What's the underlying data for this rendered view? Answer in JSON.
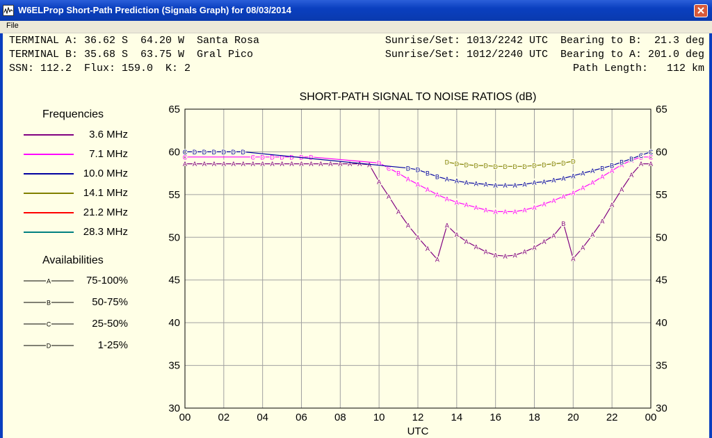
{
  "window": {
    "title": "W6ELProp Short-Path Prediction (Signals Graph) for 08/03/2014"
  },
  "menu": {
    "items": [
      "File"
    ]
  },
  "header": {
    "line1_left": "TERMINAL A: 36.62 S  64.20 W  Santa Rosa",
    "line1_right": "Sunrise/Set: 1013/2242 UTC  Bearing to B:  21.3 deg",
    "line2_left": "TERMINAL B: 35.68 S  63.75 W  Gral Pico",
    "line2_right": "Sunrise/Set: 1012/2240 UTC  Bearing to A: 201.0 deg",
    "line3_left": "SSN: 112.2  Flux: 159.0  K: 2",
    "line3_right": "Path Length:   112 km"
  },
  "legend": {
    "frequencies_heading": "Frequencies",
    "frequencies": [
      {
        "label": "3.6 MHz",
        "color": "#800080"
      },
      {
        "label": "7.1 MHz",
        "color": "#ff00ff"
      },
      {
        "label": "10.0 MHz",
        "color": "#0000a0"
      },
      {
        "label": "14.1 MHz",
        "color": "#808000"
      },
      {
        "label": "21.2 MHz",
        "color": "#ff0000"
      },
      {
        "label": "28.3 MHz",
        "color": "#008080"
      }
    ],
    "availabilities_heading": "Availabilities",
    "availabilities": [
      {
        "marker": "A",
        "label": "75-100%"
      },
      {
        "marker": "B",
        "label": "50-75%"
      },
      {
        "marker": "C",
        "label": "25-50%"
      },
      {
        "marker": "D",
        "label": "1-25%"
      }
    ]
  },
  "chart_data": {
    "type": "line",
    "title": "SHORT-PATH SIGNAL TO NOISE RATIOS (dB)",
    "xlabel": "UTC",
    "ylabel": "",
    "xlim": [
      0,
      24
    ],
    "ylim": [
      30,
      65
    ],
    "x_tick_labels": [
      "00",
      "02",
      "04",
      "06",
      "08",
      "10",
      "12",
      "14",
      "16",
      "18",
      "20",
      "22",
      "00"
    ],
    "y_ticks": [
      30,
      35,
      40,
      45,
      50,
      55,
      60,
      65
    ],
    "grid": true,
    "background": "#ffffe6",
    "series": [
      {
        "name": "3.6 MHz",
        "color": "#800080",
        "points": [
          [
            0,
            58.6,
            "A"
          ],
          [
            0.5,
            58.6,
            "A"
          ],
          [
            1,
            58.6,
            "A"
          ],
          [
            1.5,
            58.6,
            "A"
          ],
          [
            2,
            58.6,
            "A"
          ],
          [
            2.5,
            58.6,
            "A"
          ],
          [
            3,
            58.6,
            "A"
          ],
          [
            3.5,
            58.6,
            "A"
          ],
          [
            4,
            58.6,
            "A"
          ],
          [
            4.5,
            58.6,
            "A"
          ],
          [
            5,
            58.6,
            "A"
          ],
          [
            5.5,
            58.6,
            "A"
          ],
          [
            6,
            58.6,
            "A"
          ],
          [
            6.5,
            58.6,
            "A"
          ],
          [
            7,
            58.6,
            "A"
          ],
          [
            7.5,
            58.6,
            "A"
          ],
          [
            8,
            58.6,
            "A"
          ],
          [
            8.5,
            58.6,
            "A"
          ],
          [
            9,
            58.6,
            "A"
          ],
          [
            9.5,
            58.5,
            "A"
          ],
          [
            10,
            56.5,
            "A"
          ],
          [
            10.5,
            54.8,
            "A"
          ],
          [
            11,
            53.0,
            "A"
          ],
          [
            11.5,
            51.4,
            "A"
          ],
          [
            12,
            50.0,
            "A"
          ],
          [
            12.5,
            48.7,
            "A"
          ],
          [
            13,
            47.4,
            "A"
          ],
          [
            13.5,
            51.4,
            "A"
          ],
          [
            14,
            50.3,
            "A"
          ],
          [
            14.5,
            49.5,
            "A"
          ],
          [
            15,
            48.9,
            "A"
          ],
          [
            15.5,
            48.3,
            "A"
          ],
          [
            16,
            47.9,
            "A"
          ],
          [
            16.5,
            47.8,
            "A"
          ],
          [
            17,
            47.9,
            "A"
          ],
          [
            17.5,
            48.3,
            "A"
          ],
          [
            18,
            48.8,
            "A"
          ],
          [
            18.5,
            49.5,
            "A"
          ],
          [
            19,
            50.2,
            "A"
          ],
          [
            19.5,
            51.6,
            "B"
          ],
          [
            20,
            47.5,
            "A"
          ],
          [
            20.5,
            48.8,
            "A"
          ],
          [
            21,
            50.3,
            "A"
          ],
          [
            21.5,
            51.9,
            "A"
          ],
          [
            22,
            53.8,
            "A"
          ],
          [
            22.5,
            55.6,
            "A"
          ],
          [
            23,
            57.3,
            "A"
          ],
          [
            23.5,
            58.6,
            "A"
          ],
          [
            24,
            58.6,
            "A"
          ]
        ]
      },
      {
        "name": "7.1 MHz",
        "color": "#ff00ff",
        "points": [
          [
            0,
            59.4,
            "C"
          ],
          [
            3,
            59.4,
            null
          ],
          [
            3.5,
            59.4,
            "C"
          ],
          [
            4,
            59.4,
            "D"
          ],
          [
            4.5,
            59.4,
            "D"
          ],
          [
            5,
            59.4,
            "D"
          ],
          [
            5.5,
            59.4,
            "D"
          ],
          [
            6,
            59.4,
            "D"
          ],
          [
            6.5,
            59.4,
            "D"
          ],
          [
            10,
            58.7,
            "D"
          ],
          [
            10.5,
            58.1,
            "C"
          ],
          [
            11,
            57.5,
            "B"
          ],
          [
            11.5,
            56.8,
            "A"
          ],
          [
            12,
            56.2,
            "A"
          ],
          [
            12.5,
            55.6,
            "A"
          ],
          [
            13,
            55.0,
            "A"
          ],
          [
            13.5,
            54.5,
            "A"
          ],
          [
            14,
            54.1,
            "A"
          ],
          [
            14.5,
            53.8,
            "A"
          ],
          [
            15,
            53.5,
            "A"
          ],
          [
            15.5,
            53.2,
            "A"
          ],
          [
            16,
            53.0,
            "A"
          ],
          [
            16.5,
            53.0,
            "A"
          ],
          [
            17,
            53.0,
            "A"
          ],
          [
            17.5,
            53.2,
            "A"
          ],
          [
            18,
            53.5,
            "A"
          ],
          [
            18.5,
            53.9,
            "A"
          ],
          [
            19,
            54.3,
            "A"
          ],
          [
            19.5,
            54.8,
            "A"
          ],
          [
            20,
            55.2,
            "A"
          ],
          [
            20.5,
            55.8,
            "A"
          ],
          [
            21,
            56.4,
            "A"
          ],
          [
            21.5,
            57.1,
            "A"
          ],
          [
            22,
            57.8,
            "A"
          ],
          [
            22.5,
            58.5,
            "A"
          ],
          [
            23,
            59.0,
            "A"
          ],
          [
            23.5,
            59.4,
            "B"
          ],
          [
            24,
            59.4,
            "C"
          ]
        ]
      },
      {
        "name": "10.0 MHz",
        "color": "#0000a0",
        "points": [
          [
            0,
            60.0,
            "C"
          ],
          [
            0.5,
            60.0,
            "D"
          ],
          [
            1,
            60.0,
            "D"
          ],
          [
            1.5,
            60.0,
            "D"
          ],
          [
            2,
            60.0,
            "D"
          ],
          [
            2.5,
            60.0,
            "D"
          ],
          [
            3,
            60.0,
            "D"
          ],
          [
            11.5,
            58.1,
            "D"
          ],
          [
            12,
            57.9,
            "D"
          ],
          [
            12.5,
            57.5,
            "B"
          ],
          [
            13,
            57.1,
            "B"
          ],
          [
            13.5,
            56.8,
            "A"
          ],
          [
            14,
            56.6,
            "A"
          ],
          [
            14.5,
            56.4,
            "A"
          ],
          [
            15,
            56.3,
            "A"
          ],
          [
            15.5,
            56.2,
            "A"
          ],
          [
            16,
            56.1,
            "A"
          ],
          [
            16.5,
            56.1,
            "A"
          ],
          [
            17,
            56.1,
            "A"
          ],
          [
            17.5,
            56.2,
            "A"
          ],
          [
            18,
            56.4,
            "A"
          ],
          [
            18.5,
            56.5,
            "A"
          ],
          [
            19,
            56.7,
            "A"
          ],
          [
            19.5,
            56.9,
            "A"
          ],
          [
            20,
            57.2,
            "A"
          ],
          [
            20.5,
            57.5,
            "A"
          ],
          [
            21,
            57.8,
            "A"
          ],
          [
            21.5,
            58.1,
            "B"
          ],
          [
            22,
            58.4,
            "B"
          ],
          [
            22.5,
            58.8,
            "B"
          ],
          [
            23,
            59.2,
            "B"
          ],
          [
            23.5,
            59.6,
            "C"
          ],
          [
            24,
            60.0,
            "C"
          ]
        ]
      },
      {
        "name": "14.1 MHz",
        "color": "#808000",
        "points": [
          [
            13.5,
            58.8,
            "D"
          ],
          [
            14,
            58.6,
            "D"
          ],
          [
            14.5,
            58.5,
            "D"
          ],
          [
            15,
            58.4,
            "D"
          ],
          [
            15.5,
            58.4,
            "D"
          ],
          [
            16,
            58.3,
            "D"
          ],
          [
            16.5,
            58.3,
            "D"
          ],
          [
            17,
            58.3,
            "D"
          ],
          [
            17.5,
            58.3,
            "D"
          ],
          [
            18,
            58.4,
            "D"
          ],
          [
            18.5,
            58.5,
            "D"
          ],
          [
            19,
            58.6,
            "D"
          ],
          [
            19.5,
            58.7,
            "D"
          ],
          [
            20,
            58.9,
            "D"
          ]
        ]
      }
    ]
  }
}
